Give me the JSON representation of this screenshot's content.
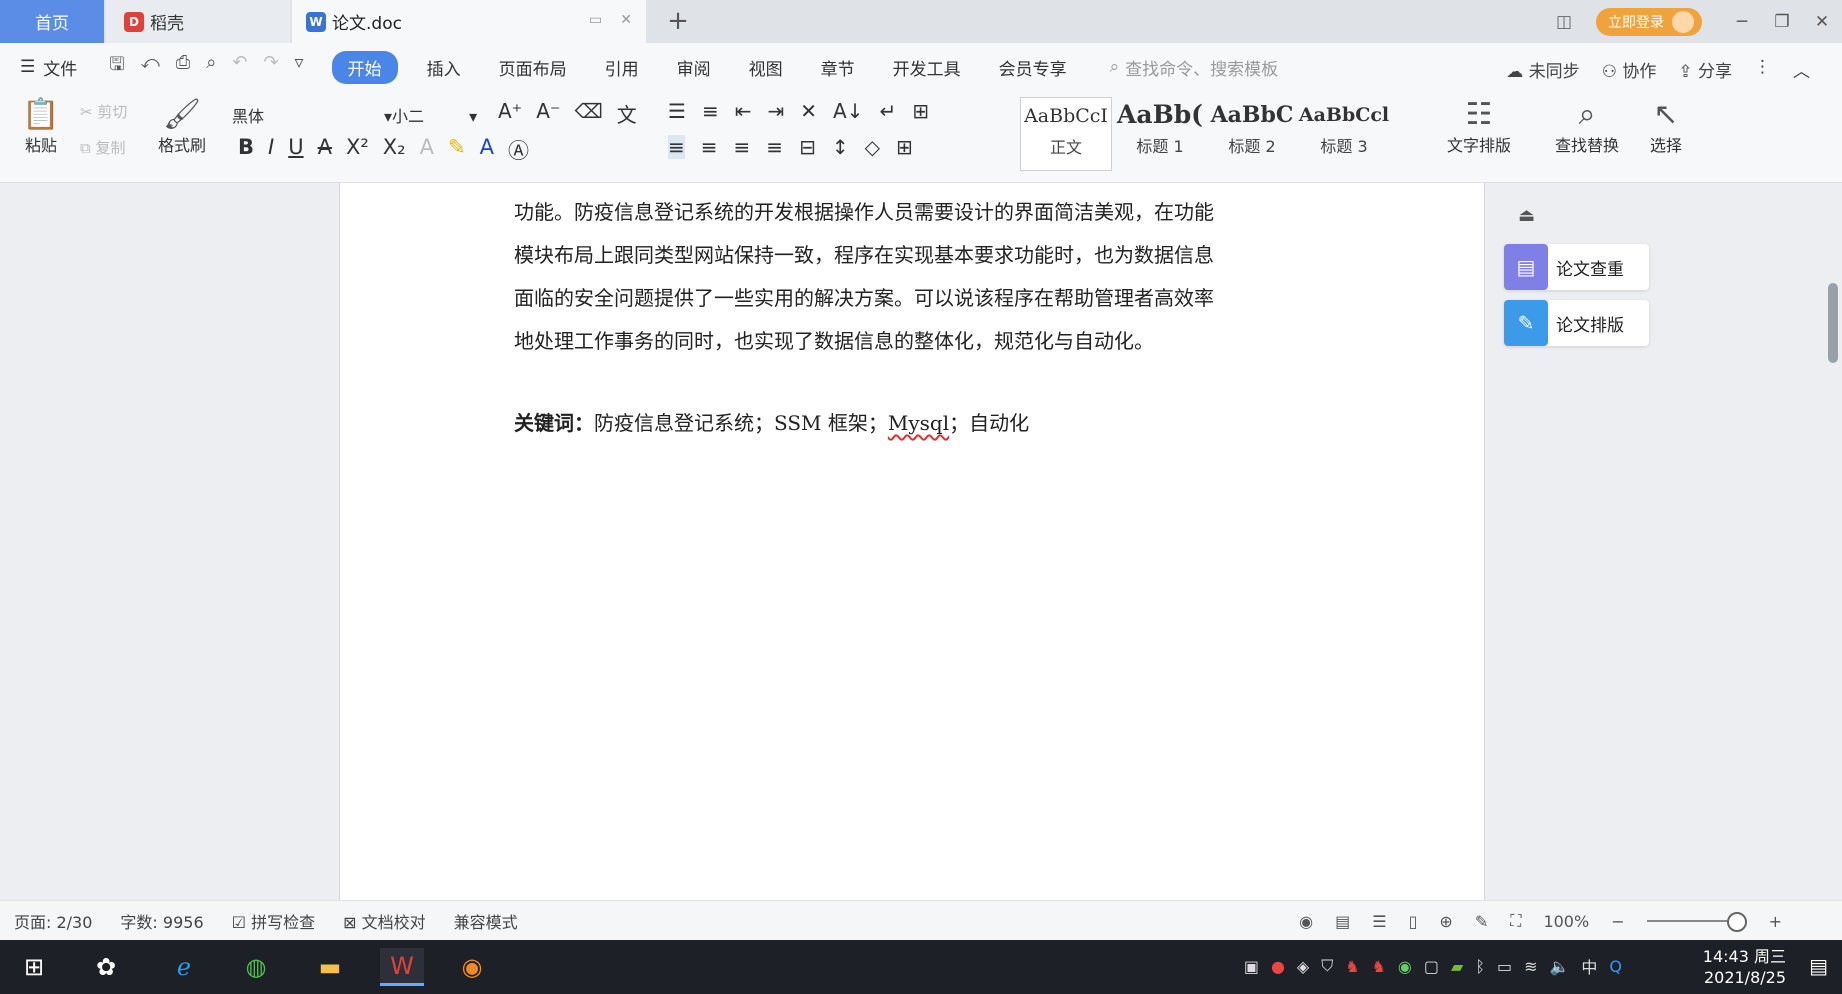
{
  "tabs": {
    "home": "首页",
    "daoke": "稻壳",
    "doc": "论文.doc",
    "doc_icon": "W",
    "daoke_icon": "D"
  },
  "top_right": {
    "login": "立即登录"
  },
  "menu": {
    "file": "文件",
    "tabs": [
      "开始",
      "插入",
      "页面布局",
      "引用",
      "审阅",
      "视图",
      "章节",
      "开发工具",
      "会员专享"
    ],
    "search": "查找命令、搜索模板",
    "unsync": "未同步",
    "collab": "协作",
    "share": "分享"
  },
  "ribbon": {
    "paste": "粘贴",
    "cut": "剪切",
    "copy": "复制",
    "format_painter": "格式刷",
    "font": "黑体",
    "size": "小二",
    "styles": [
      {
        "sample": "AaBbCcI",
        "name": "正文"
      },
      {
        "sample": "AaBb(",
        "name": "标题 1"
      },
      {
        "sample": "AaBbC",
        "name": "标题 2"
      },
      {
        "sample": "AaBbCcl",
        "name": "标题 3"
      }
    ],
    "text_layout": "文字排版",
    "find_replace": "查找替换",
    "select": "选择"
  },
  "document": {
    "lines": [
      "功能。防疫信息登记系统的开发根据操作人员需要设计的界面简洁美观，在功能",
      "模块布局上跟同类型网站保持一致，程序在实现基本要求功能时，也为数据信息",
      "面临的安全问题提供了一些实用的解决方案。可以说该程序在帮助管理者高效率",
      "地处理工作事务的同时，也实现了数据信息的整体化，规范化与自动化。"
    ],
    "kw_label": "关键词：",
    "kw_text1": "防疫信息登记系统；SSM 框架；",
    "kw_misspelled": "Mysql",
    "kw_text2": "；自动化"
  },
  "side_panel": {
    "check": "论文查重",
    "layout": "论文排版"
  },
  "status": {
    "page": "页面: 2/30",
    "words": "字数: 9956",
    "spell": "拼写检查",
    "proof": "文档校对",
    "compat": "兼容模式",
    "zoom": "100%"
  },
  "taskbar": {
    "ime": "中",
    "time": "14:43 周三",
    "date": "2021/8/25"
  }
}
